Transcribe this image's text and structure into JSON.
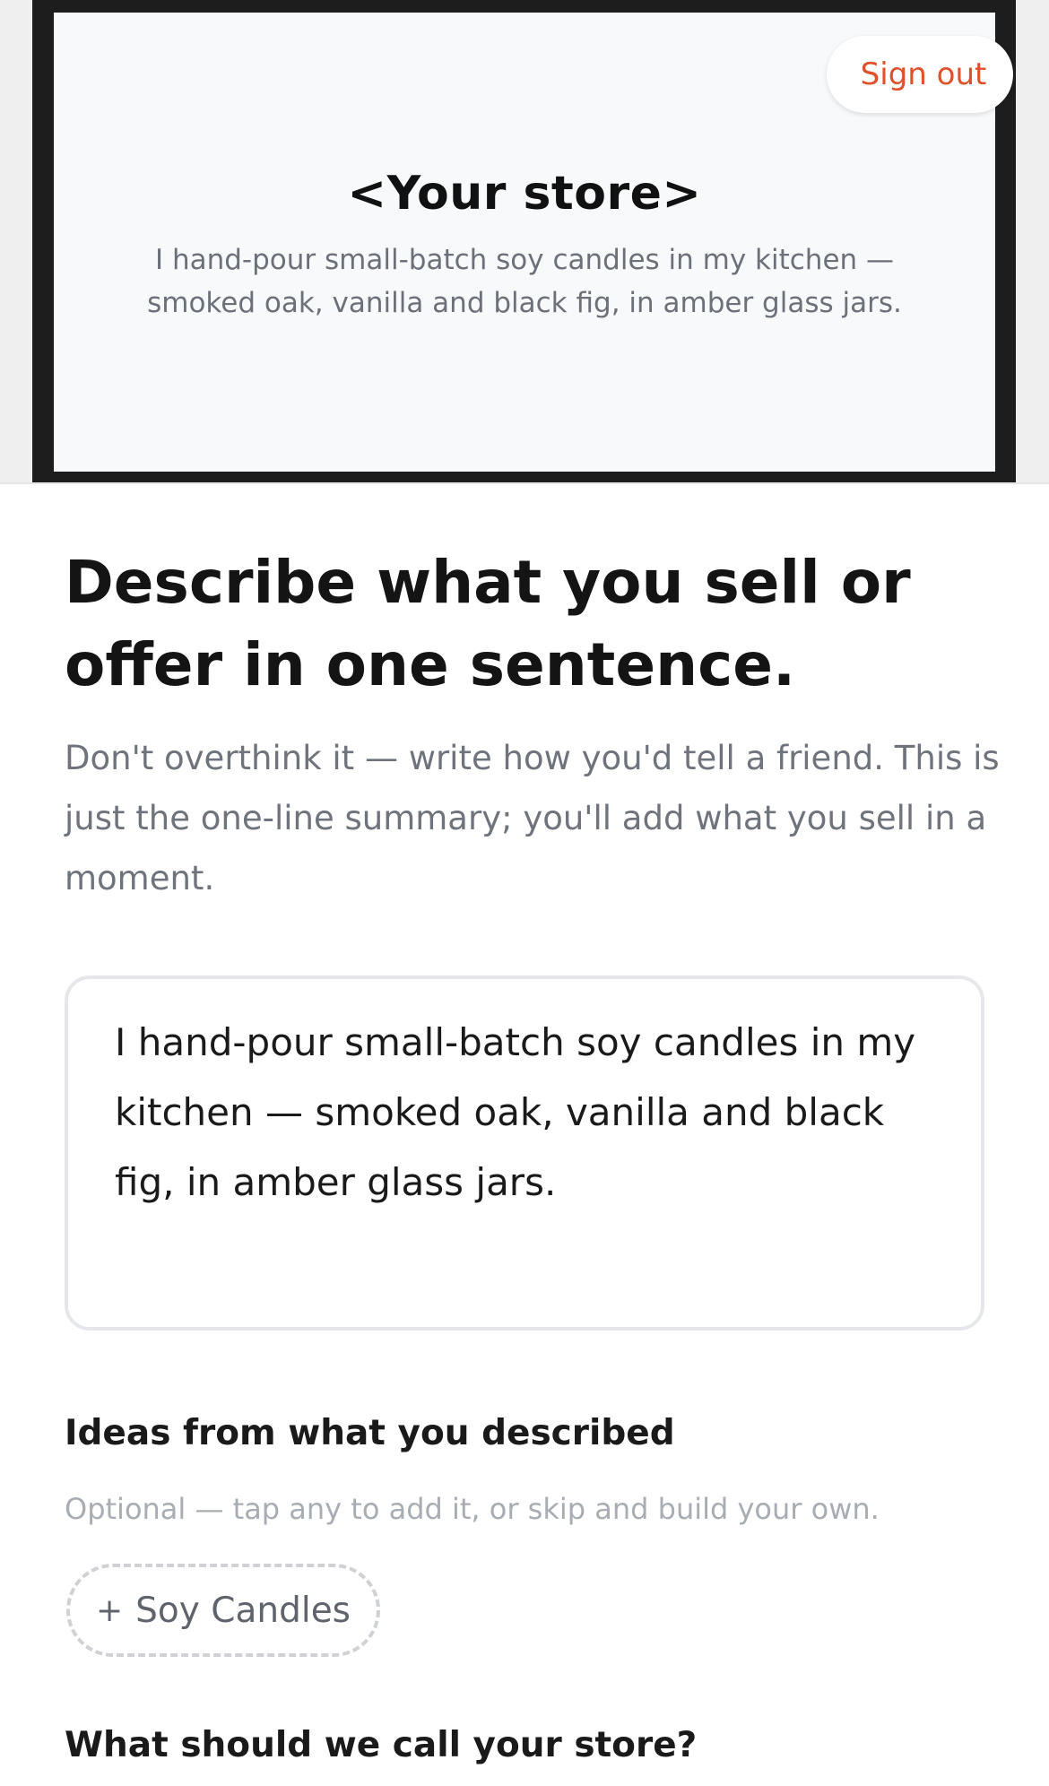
{
  "header": {
    "sign_out_label": "Sign out"
  },
  "preview": {
    "store_name": "<Your store>",
    "description": "I hand-pour small-batch soy candles in my kitchen — smoked oak, vanilla and black fig, in amber glass jars."
  },
  "main": {
    "heading": "Describe what you sell or offer in one sentence.",
    "subtext": "Don't overthink it — write how you'd tell a friend. This is just the one-line summary; you'll add what you sell in a moment.",
    "description_value": "I hand-pour small-batch soy candles in my kitchen — smoked oak, vanilla and black fig, in amber glass jars."
  },
  "ideas": {
    "title": "Ideas from what you described",
    "subtitle": "Optional — tap any to add it, or skip and build your own.",
    "chips": [
      {
        "icon": "plus-icon",
        "plus": "+",
        "label": "Soy Candles"
      }
    ]
  },
  "store_name_section": {
    "question": "What should we call your store?"
  },
  "colors": {
    "accent": "#e0502a",
    "frame": "#1d1d1d"
  }
}
